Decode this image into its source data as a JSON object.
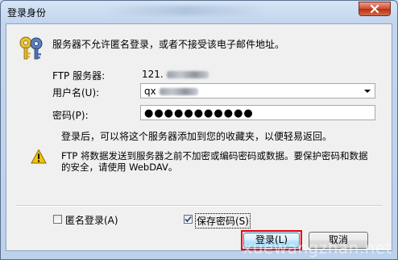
{
  "window": {
    "title": "登录身份",
    "close_icon": "close-icon"
  },
  "header": {
    "message": "服务器不允许匿名登录，或者不接受该电子邮件地址。",
    "icon": "keys-icon"
  },
  "form": {
    "server_label": "FTP 服务器:",
    "server_value_prefix": "121.",
    "username_label": "用户名(U):",
    "username_value_prefix": "qx",
    "password_label": "密码(P):",
    "password_value": "●●●●●●●●●●●"
  },
  "info": {
    "after_login": "登录后，可以将这个服务器添加到您的收藏夹，以便轻易返回。",
    "warning_line1": "FTP 将数据发送到服务器之前不加密或编码密码或数据。要保护密码和数据",
    "warning_line2": "的安全，请使用 WebDAV。",
    "warning_icon": "warning-icon"
  },
  "options": {
    "anonymous_label": "匿名登录(A)",
    "anonymous_checked": false,
    "save_password_label": "保存密码(S)",
    "save_password_checked": true
  },
  "buttons": {
    "login_label": "登录(L)",
    "cancel_label": "取消"
  },
  "watermark": "xuewangzhan.net",
  "colors": {
    "highlight": "#e5000a",
    "titlebar": "#c3d6ee",
    "warning": "#f4c400"
  }
}
